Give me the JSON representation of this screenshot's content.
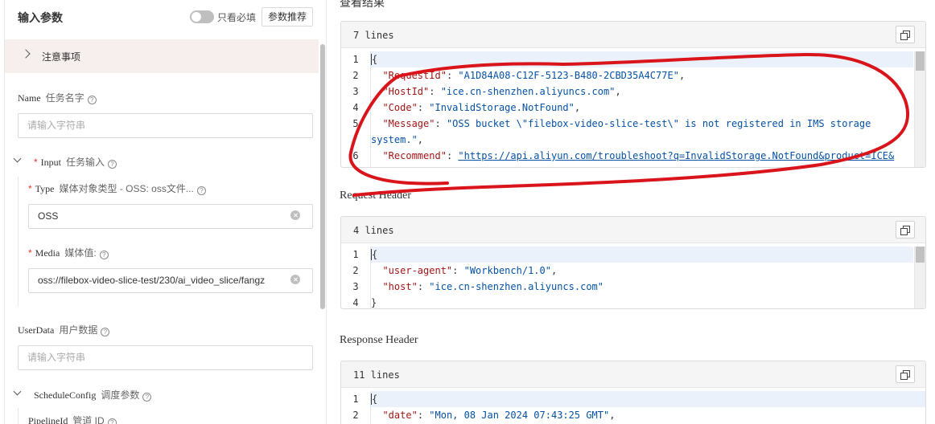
{
  "left": {
    "header_title": "输入参数",
    "toggle_label": "只看必填",
    "recommend_button": "参数推荐",
    "notice_label": "注意事项",
    "name": {
      "en": "Name",
      "cn": "任务名字",
      "placeholder": "请输入字符串"
    },
    "input": {
      "en": "Input",
      "cn": "任务输入",
      "type": {
        "en": "Type",
        "cn": "媒体对象类型 - OSS: oss文件...",
        "value": "OSS"
      },
      "media": {
        "en": "Media",
        "cn": "媒体值:",
        "value": "oss://filebox-video-slice-test/230/ai_video_slice/fangz"
      }
    },
    "userdata": {
      "en": "UserData",
      "cn": "用户数据",
      "placeholder": "请输入字符串"
    },
    "schedule": {
      "en": "ScheduleConfig",
      "cn": "调度参数"
    },
    "pipeline": {
      "en": "PipelineId",
      "cn": "管道 ID"
    },
    "help_glyph": "?"
  },
  "right": {
    "result_title": "查看结果",
    "result": {
      "count": "7 lines",
      "line_numbers": [
        "1",
        "2",
        "3",
        "4",
        "5",
        "",
        "6"
      ],
      "lines": [
        [
          {
            "t": "p",
            "v": "{"
          }
        ],
        [
          {
            "t": "p",
            "v": "  "
          },
          {
            "t": "k",
            "v": "\"RequestId\""
          },
          {
            "t": "p",
            "v": ": "
          },
          {
            "t": "s",
            "v": "\"A1D84A08-C12F-5123-B480-2CBD35A4C77E\""
          },
          {
            "t": "p",
            "v": ","
          }
        ],
        [
          {
            "t": "p",
            "v": "  "
          },
          {
            "t": "k",
            "v": "\"HostId\""
          },
          {
            "t": "p",
            "v": ": "
          },
          {
            "t": "s",
            "v": "\"ice.cn-shenzhen.aliyuncs.com\""
          },
          {
            "t": "p",
            "v": ","
          }
        ],
        [
          {
            "t": "p",
            "v": "  "
          },
          {
            "t": "k",
            "v": "\"Code\""
          },
          {
            "t": "p",
            "v": ": "
          },
          {
            "t": "s",
            "v": "\"InvalidStorage.NotFound\""
          },
          {
            "t": "p",
            "v": ","
          }
        ],
        [
          {
            "t": "p",
            "v": "  "
          },
          {
            "t": "k",
            "v": "\"Message\""
          },
          {
            "t": "p",
            "v": ": "
          },
          {
            "t": "s",
            "v": "\"OSS bucket \\\"filebox-video-slice-test\\\" is not registered in IMS storage"
          }
        ],
        [
          {
            "t": "s",
            "v": "system.\""
          },
          {
            "t": "p",
            "v": ","
          }
        ],
        [
          {
            "t": "p",
            "v": "  "
          },
          {
            "t": "k",
            "v": "\"Recommend\""
          },
          {
            "t": "p",
            "v": ": "
          },
          {
            "t": "l",
            "v": "\"https://api.aliyun.com/troubleshoot?q=InvalidStorage.NotFound&product=ICE&"
          }
        ]
      ]
    },
    "request_title": "Request Header",
    "request": {
      "count": "4 lines",
      "line_numbers": [
        "1",
        "2",
        "3",
        "4"
      ],
      "lines": [
        [
          {
            "t": "p",
            "v": "{"
          }
        ],
        [
          {
            "t": "p",
            "v": "  "
          },
          {
            "t": "k",
            "v": "\"user-agent\""
          },
          {
            "t": "p",
            "v": ": "
          },
          {
            "t": "s",
            "v": "\"Workbench/1.0\""
          },
          {
            "t": "p",
            "v": ","
          }
        ],
        [
          {
            "t": "p",
            "v": "  "
          },
          {
            "t": "k",
            "v": "\"host\""
          },
          {
            "t": "p",
            "v": ": "
          },
          {
            "t": "s",
            "v": "\"ice.cn-shenzhen.aliyuncs.com\""
          }
        ],
        [
          {
            "t": "p",
            "v": "}"
          }
        ]
      ]
    },
    "response_title": "Response Header",
    "response": {
      "count": "11 lines",
      "line_numbers": [
        "1",
        "2"
      ],
      "lines": [
        [
          {
            "t": "p",
            "v": "{"
          }
        ],
        [
          {
            "t": "p",
            "v": "  "
          },
          {
            "t": "k",
            "v": "\"date\""
          },
          {
            "t": "p",
            "v": ": "
          },
          {
            "t": "s",
            "v": "\"Mon, 08 Jan 2024 07:43:25 GMT\""
          },
          {
            "t": "p",
            "v": ","
          }
        ]
      ]
    }
  },
  "colors": {
    "key": "#a31515",
    "string": "#0451a5",
    "annotation": "#d9141b",
    "notice_bg": "#f7efed"
  }
}
